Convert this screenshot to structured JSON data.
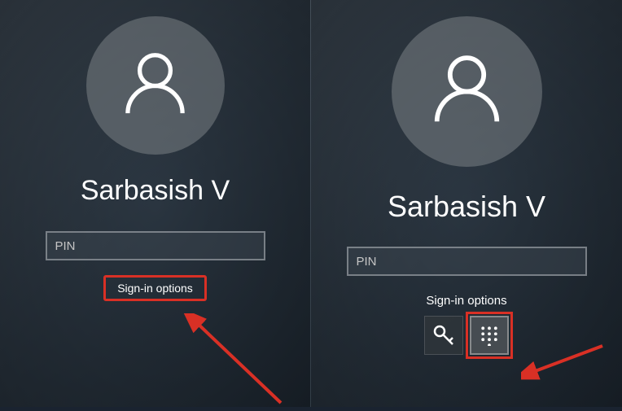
{
  "left": {
    "username": "Sarbasish V",
    "pin_placeholder": "PIN",
    "signin_options_label": "Sign-in options"
  },
  "right": {
    "username": "Sarbasish V",
    "pin_placeholder": "PIN",
    "signin_options_label": "Sign-in options"
  },
  "colors": {
    "highlight": "#d93025"
  }
}
